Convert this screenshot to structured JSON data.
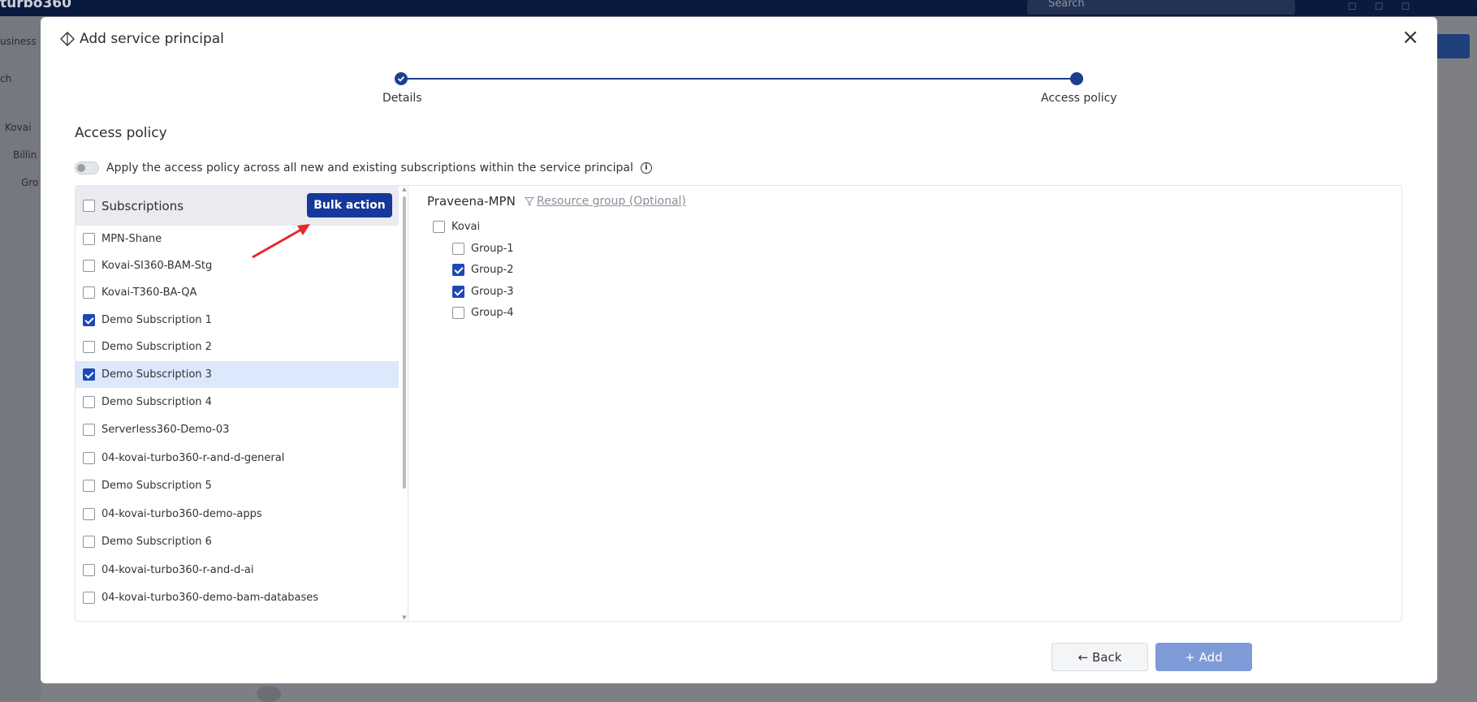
{
  "background": {
    "brand": "turbo360",
    "search_placeholder": "Search",
    "side_items": [
      "usiness",
      "ch",
      "Kovai",
      "Billin",
      "Gro"
    ]
  },
  "modal": {
    "title": "Add service principal",
    "steps": [
      {
        "label": "Details",
        "state": "done"
      },
      {
        "label": "Access policy",
        "state": "active"
      }
    ],
    "section_title": "Access policy",
    "toggle": {
      "label": "Apply the access policy across all new and existing subscriptions within the service principal",
      "on": false
    },
    "subscriptions": {
      "header": "Subscriptions",
      "header_checked": false,
      "bulk_action_label": "Bulk action",
      "items": [
        {
          "name": "MPN-Shane",
          "checked": false,
          "selected": false
        },
        {
          "name": "Kovai-SI360-BAM-Stg",
          "checked": false,
          "selected": false
        },
        {
          "name": "Kovai-T360-BA-QA",
          "checked": false,
          "selected": false
        },
        {
          "name": "Demo Subscription 1",
          "checked": true,
          "selected": false
        },
        {
          "name": "Demo Subscription 2",
          "checked": false,
          "selected": false
        },
        {
          "name": "Demo Subscription 3",
          "checked": true,
          "selected": true
        },
        {
          "name": "Demo Subscription 4",
          "checked": false,
          "selected": false
        },
        {
          "name": "Serverless360-Demo-03",
          "checked": false,
          "selected": false
        },
        {
          "name": "04-kovai-turbo360-r-and-d-general",
          "checked": false,
          "selected": false
        },
        {
          "name": "Demo Subscription 5",
          "checked": false,
          "selected": false
        },
        {
          "name": "04-kovai-turbo360-demo-apps",
          "checked": false,
          "selected": false
        },
        {
          "name": "Demo Subscription 6",
          "checked": false,
          "selected": false
        },
        {
          "name": "04-kovai-turbo360-r-and-d-ai",
          "checked": false,
          "selected": false
        },
        {
          "name": "04-kovai-turbo360-demo-bam-databases",
          "checked": false,
          "selected": false
        }
      ]
    },
    "resource_groups": {
      "title": "Praveena-MPN",
      "filter_label": "Resource group (Optional)",
      "root": {
        "name": "Kovai",
        "checked": false
      },
      "groups": [
        {
          "name": "Group-1",
          "checked": false
        },
        {
          "name": "Group-2",
          "checked": true
        },
        {
          "name": "Group-3",
          "checked": true
        },
        {
          "name": "Group-4",
          "checked": false
        }
      ]
    },
    "buttons": {
      "back": "Back",
      "add": "Add"
    }
  },
  "colors": {
    "primary": "#16389a",
    "selected_row": "#dce8fb",
    "add_disabled": "#7f9bd7",
    "annotation_arrow": "#e8262a"
  }
}
